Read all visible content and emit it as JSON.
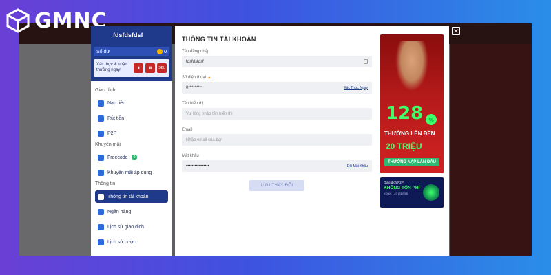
{
  "brand": {
    "name": "GMNC"
  },
  "sidebar": {
    "username": "fdsfdsfdsf",
    "balance_label": "Số dư",
    "balance_value": "0",
    "verify_text": "Xác thực & nhận thưởng ngay!",
    "verify_badge": "SĐL",
    "sections": [
      {
        "title": "Giao dịch",
        "items": [
          {
            "label": "Nạp tiền",
            "icon": "deposit-icon",
            "color": "#2e6bd8"
          },
          {
            "label": "Rút tiền",
            "icon": "withdraw-icon",
            "color": "#2e6bd8"
          },
          {
            "label": "P2P",
            "icon": "p2p-icon",
            "color": "#2e6bd8"
          }
        ]
      },
      {
        "title": "Khuyến mãi",
        "items": [
          {
            "label": "Freecode",
            "icon": "freecode-icon",
            "color": "#2e6bd8",
            "badge": "0"
          },
          {
            "label": "Khuyến mãi áp dụng",
            "icon": "promo-icon",
            "color": "#2e6bd8"
          }
        ]
      },
      {
        "title": "Thông tin",
        "items": [
          {
            "label": "Thông tin tài khoản",
            "icon": "account-icon",
            "color": "#ffffff",
            "active": true
          },
          {
            "label": "Ngân hàng",
            "icon": "bank-icon",
            "color": "#2e6bd8"
          },
          {
            "label": "Lịch sử giao dịch",
            "icon": "history-icon",
            "color": "#2e6bd8"
          },
          {
            "label": "Lịch sử cược",
            "icon": "bet-history-icon",
            "color": "#2e6bd8"
          }
        ]
      }
    ]
  },
  "form": {
    "title": "THÔNG TIN TÀI KHOẢN",
    "username_label": "Tên đăng nhập",
    "username_value": "fdsfdsfdsf",
    "phone_label": "Số điện thoại",
    "phone_value": "0*********",
    "phone_link": "Xác Thực Ngay",
    "display_label": "Tên hiển thị",
    "display_placeholder": "Vui lòng nhập tên hiển thị",
    "email_label": "Email",
    "email_placeholder": "Nhập email của bạn",
    "password_label": "Mật khẩu",
    "password_value": "••••••••••••••••",
    "password_link": "Đổi Mật Khẩu",
    "save_label": "LƯU THAY ĐỔI"
  },
  "banner1": {
    "percent": "128",
    "percent_sign": "%",
    "line1": "THƯỞNG LÊN ĐẾN",
    "line2": "20 TRIỆU",
    "cta": "THƯỞNG NẠP LẦN ĐẦU"
  },
  "banner2": {
    "top": "Giao dịch P2P",
    "main": "KHÔNG TỐN PHÍ",
    "sub": "KOAH → 0 (EDT98)"
  },
  "close": {
    "symbol": "✕"
  }
}
